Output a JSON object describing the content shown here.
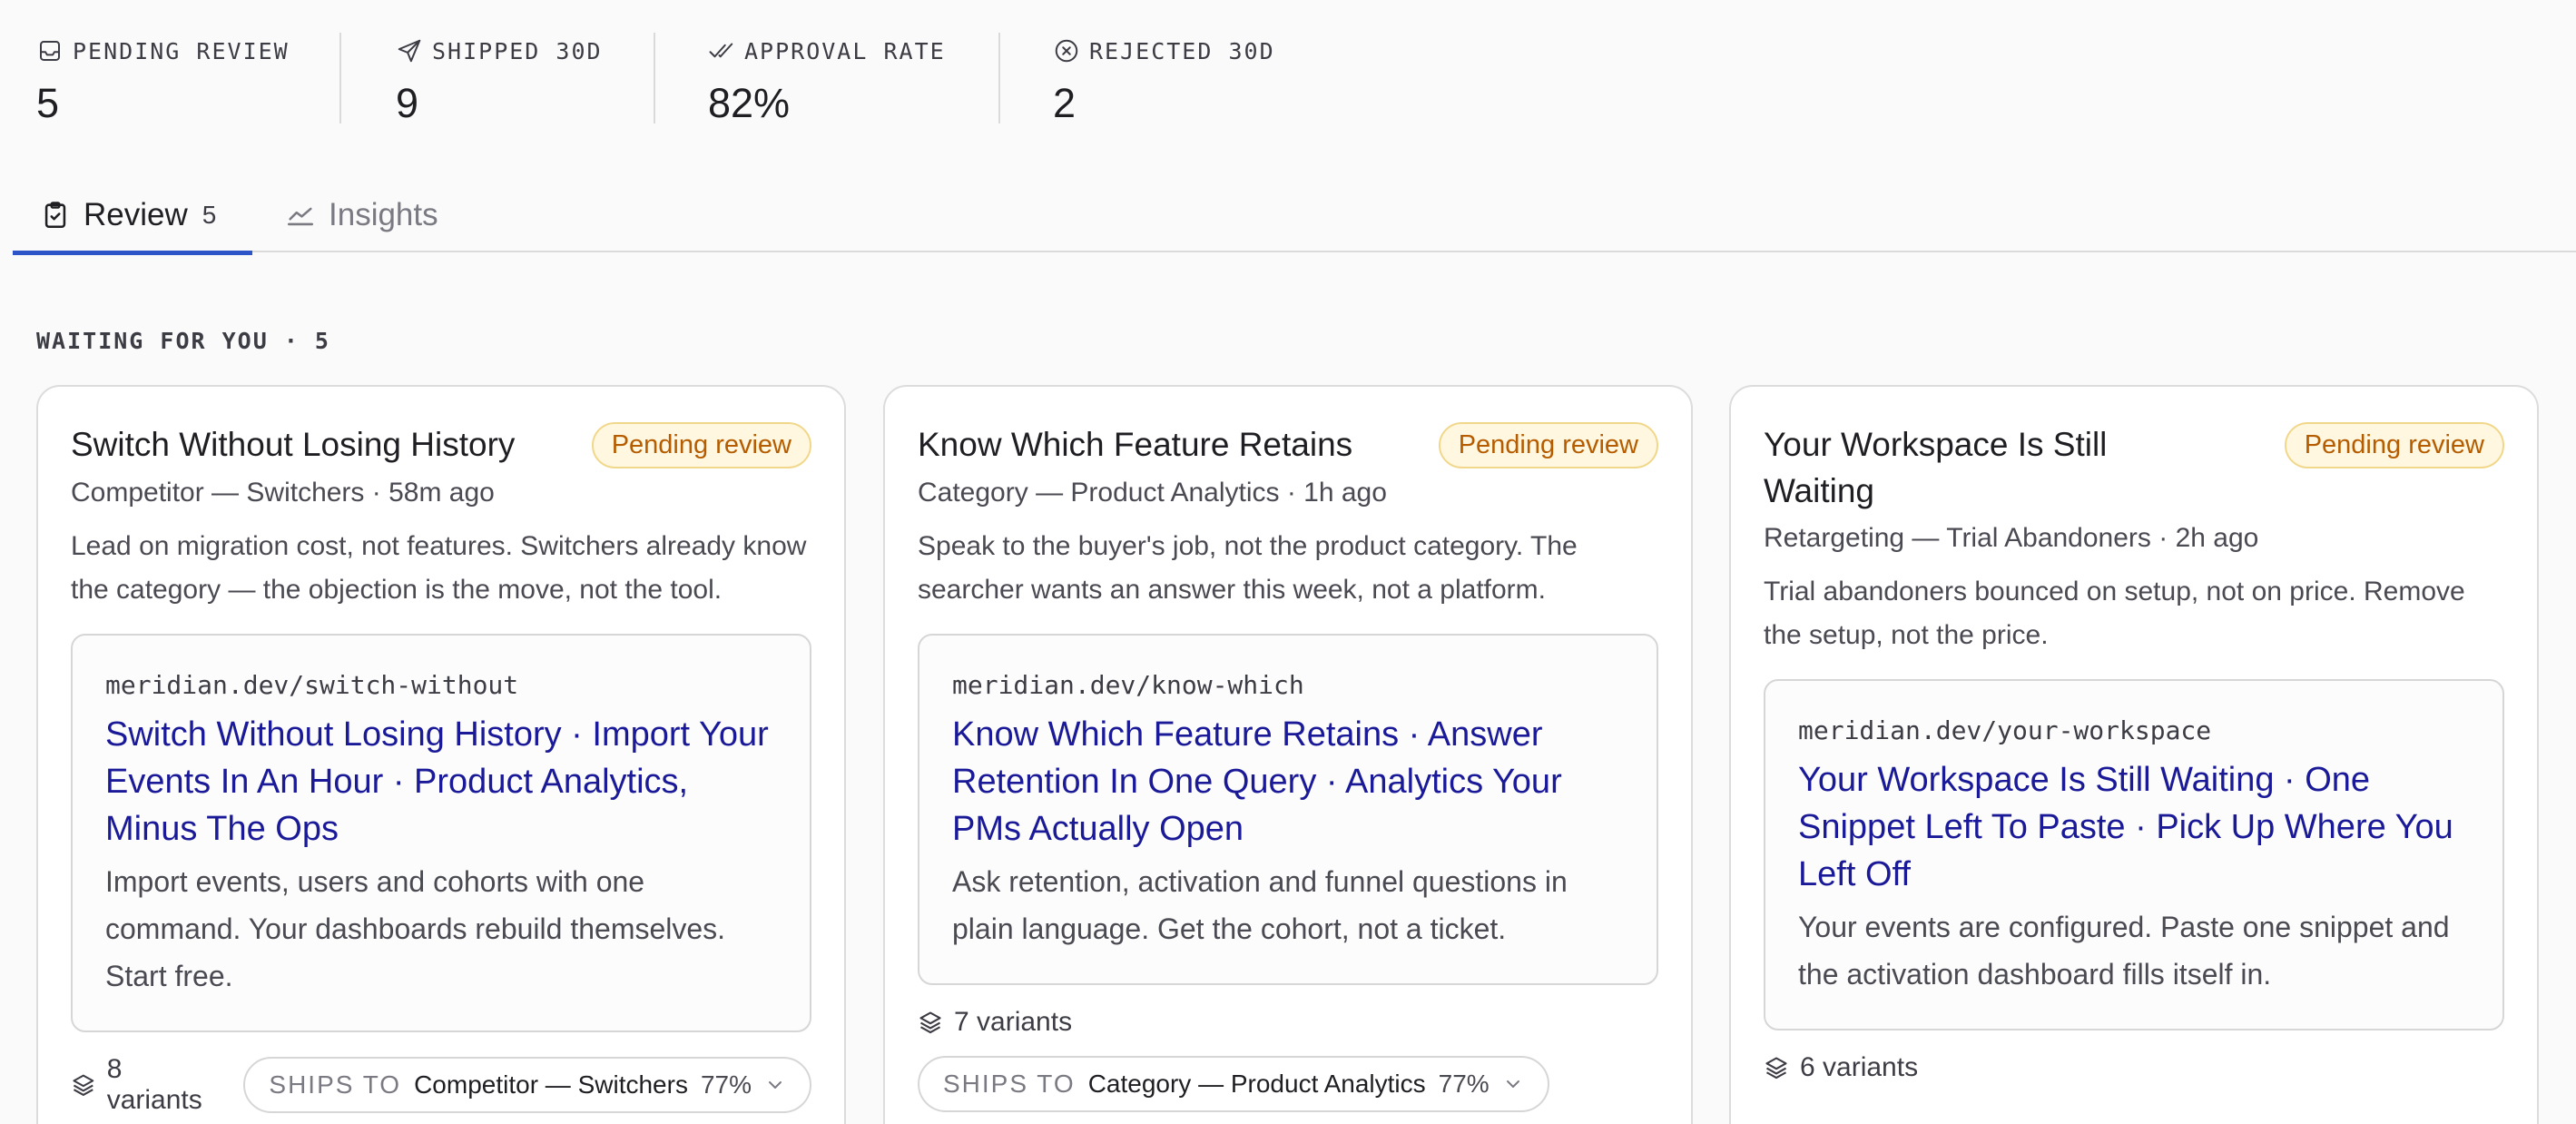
{
  "stats": [
    {
      "label": "PENDING REVIEW",
      "value": "5",
      "icon": "inbox-icon"
    },
    {
      "label": "SHIPPED 30D",
      "value": "9",
      "icon": "send-icon"
    },
    {
      "label": "APPROVAL RATE",
      "value": "82%",
      "icon": "double-check-icon"
    },
    {
      "label": "REJECTED 30D",
      "value": "2",
      "icon": "x-circle-icon"
    }
  ],
  "tabs": {
    "review": {
      "label": "Review",
      "count": "5",
      "icon": "clipboard-check-icon"
    },
    "insights": {
      "label": "Insights",
      "icon": "line-chart-icon"
    }
  },
  "section_label": "WAITING FOR YOU · 5",
  "colors": {
    "accent": "#2d55c8",
    "badge_text": "#b65c00",
    "badge_bg": "#fff7df",
    "ad_headline": "#1a1a99"
  },
  "cards": [
    {
      "title": "Switch Without Losing History",
      "status": "Pending review",
      "meta": "Competitor — Switchers · 58m ago",
      "description": "Lead on migration cost, not features. Switchers already know the category — the objection is the move, not the tool.",
      "ad": {
        "url": "meridian.dev/switch-without",
        "headline": "Switch Without Losing History · Import Your Events In An Hour · Product Analytics, Minus The Ops",
        "body": "Import events, users and cohorts with one command. Your dashboards rebuild themselves. Start free."
      },
      "variants": "8 variants",
      "ships_label": "SHIPS TO",
      "ships_target": "Competitor — Switchers",
      "ships_pct": "77%"
    },
    {
      "title": "Know Which Feature Retains",
      "status": "Pending review",
      "meta": "Category — Product Analytics · 1h ago",
      "description": "Speak to the buyer's job, not the product category. The searcher wants an answer this week, not a platform.",
      "ad": {
        "url": "meridian.dev/know-which",
        "headline": "Know Which Feature Retains · Answer Retention In One Query · Analytics Your PMs Actually Open",
        "body": "Ask retention, activation and funnel questions in plain language. Get the cohort, not a ticket."
      },
      "variants": "7 variants",
      "ships_label": "SHIPS TO",
      "ships_target": "Category — Product Analytics",
      "ships_pct": "77%"
    },
    {
      "title": "Your Workspace Is Still Waiting",
      "status": "Pending review",
      "meta": "Retargeting — Trial Abandoners · 2h ago",
      "description": "Trial abandoners bounced on setup, not on price. Remove the setup, not the price.",
      "ad": {
        "url": "meridian.dev/your-workspace",
        "headline": "Your Workspace Is Still Waiting · One Snippet Left To Paste · Pick Up Where You Left Off",
        "body": "Your events are configured. Paste one snippet and the activation dashboard fills itself in."
      },
      "variants": "6 variants"
    }
  ]
}
